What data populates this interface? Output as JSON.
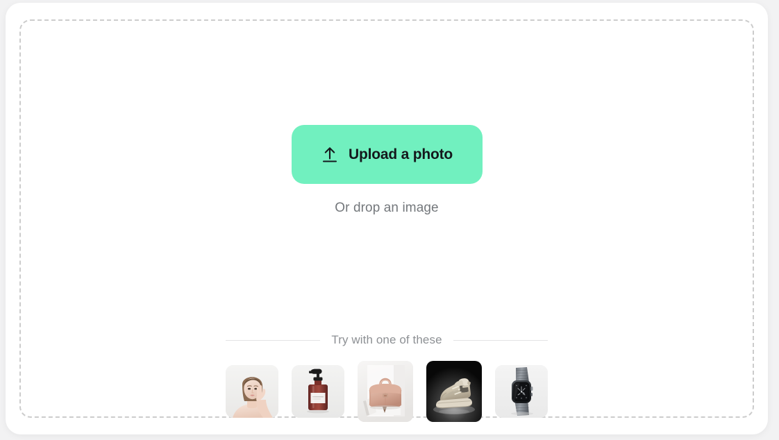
{
  "dropzone": {
    "upload_button_label": "Upload a photo",
    "upload_icon": "upload-arrow-icon",
    "drop_hint": "Or drop an image"
  },
  "samples": {
    "divider_label": "Try with one of these",
    "items": [
      {
        "name": "model-portrait",
        "alt": "Woman touching her face, beauty portrait"
      },
      {
        "name": "pump-bottle",
        "alt": "Amber cosmetic pump bottle with white label"
      },
      {
        "name": "handbag",
        "alt": "Pink leather top-handle handbag"
      },
      {
        "name": "sneaker",
        "alt": "Beige high-top sneaker on dark background"
      },
      {
        "name": "smartwatch",
        "alt": "Black smartwatch with metal band"
      }
    ]
  },
  "colors": {
    "accent_green": "#71f0bf",
    "button_text": "#14181c",
    "hint_text": "#74787c",
    "divider_text": "#8d9094",
    "dashed_border": "#cccccc",
    "page_background": "#f2f2f3",
    "card_background": "#ffffff"
  }
}
